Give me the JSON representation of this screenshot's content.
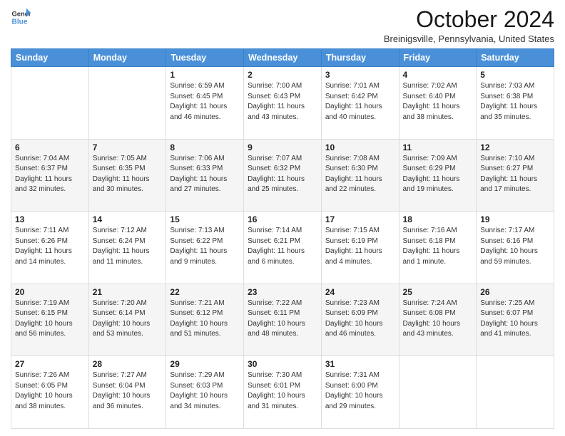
{
  "header": {
    "logo_line1": "General",
    "logo_line2": "Blue",
    "month": "October 2024",
    "location": "Breinigsville, Pennsylvania, United States"
  },
  "weekdays": [
    "Sunday",
    "Monday",
    "Tuesday",
    "Wednesday",
    "Thursday",
    "Friday",
    "Saturday"
  ],
  "weeks": [
    [
      {
        "day": "",
        "sunrise": "",
        "sunset": "",
        "daylight": ""
      },
      {
        "day": "",
        "sunrise": "",
        "sunset": "",
        "daylight": ""
      },
      {
        "day": "1",
        "sunrise": "Sunrise: 6:59 AM",
        "sunset": "Sunset: 6:45 PM",
        "daylight": "Daylight: 11 hours and 46 minutes."
      },
      {
        "day": "2",
        "sunrise": "Sunrise: 7:00 AM",
        "sunset": "Sunset: 6:43 PM",
        "daylight": "Daylight: 11 hours and 43 minutes."
      },
      {
        "day": "3",
        "sunrise": "Sunrise: 7:01 AM",
        "sunset": "Sunset: 6:42 PM",
        "daylight": "Daylight: 11 hours and 40 minutes."
      },
      {
        "day": "4",
        "sunrise": "Sunrise: 7:02 AM",
        "sunset": "Sunset: 6:40 PM",
        "daylight": "Daylight: 11 hours and 38 minutes."
      },
      {
        "day": "5",
        "sunrise": "Sunrise: 7:03 AM",
        "sunset": "Sunset: 6:38 PM",
        "daylight": "Daylight: 11 hours and 35 minutes."
      }
    ],
    [
      {
        "day": "6",
        "sunrise": "Sunrise: 7:04 AM",
        "sunset": "Sunset: 6:37 PM",
        "daylight": "Daylight: 11 hours and 32 minutes."
      },
      {
        "day": "7",
        "sunrise": "Sunrise: 7:05 AM",
        "sunset": "Sunset: 6:35 PM",
        "daylight": "Daylight: 11 hours and 30 minutes."
      },
      {
        "day": "8",
        "sunrise": "Sunrise: 7:06 AM",
        "sunset": "Sunset: 6:33 PM",
        "daylight": "Daylight: 11 hours and 27 minutes."
      },
      {
        "day": "9",
        "sunrise": "Sunrise: 7:07 AM",
        "sunset": "Sunset: 6:32 PM",
        "daylight": "Daylight: 11 hours and 25 minutes."
      },
      {
        "day": "10",
        "sunrise": "Sunrise: 7:08 AM",
        "sunset": "Sunset: 6:30 PM",
        "daylight": "Daylight: 11 hours and 22 minutes."
      },
      {
        "day": "11",
        "sunrise": "Sunrise: 7:09 AM",
        "sunset": "Sunset: 6:29 PM",
        "daylight": "Daylight: 11 hours and 19 minutes."
      },
      {
        "day": "12",
        "sunrise": "Sunrise: 7:10 AM",
        "sunset": "Sunset: 6:27 PM",
        "daylight": "Daylight: 11 hours and 17 minutes."
      }
    ],
    [
      {
        "day": "13",
        "sunrise": "Sunrise: 7:11 AM",
        "sunset": "Sunset: 6:26 PM",
        "daylight": "Daylight: 11 hours and 14 minutes."
      },
      {
        "day": "14",
        "sunrise": "Sunrise: 7:12 AM",
        "sunset": "Sunset: 6:24 PM",
        "daylight": "Daylight: 11 hours and 11 minutes."
      },
      {
        "day": "15",
        "sunrise": "Sunrise: 7:13 AM",
        "sunset": "Sunset: 6:22 PM",
        "daylight": "Daylight: 11 hours and 9 minutes."
      },
      {
        "day": "16",
        "sunrise": "Sunrise: 7:14 AM",
        "sunset": "Sunset: 6:21 PM",
        "daylight": "Daylight: 11 hours and 6 minutes."
      },
      {
        "day": "17",
        "sunrise": "Sunrise: 7:15 AM",
        "sunset": "Sunset: 6:19 PM",
        "daylight": "Daylight: 11 hours and 4 minutes."
      },
      {
        "day": "18",
        "sunrise": "Sunrise: 7:16 AM",
        "sunset": "Sunset: 6:18 PM",
        "daylight": "Daylight: 11 hours and 1 minute."
      },
      {
        "day": "19",
        "sunrise": "Sunrise: 7:17 AM",
        "sunset": "Sunset: 6:16 PM",
        "daylight": "Daylight: 10 hours and 59 minutes."
      }
    ],
    [
      {
        "day": "20",
        "sunrise": "Sunrise: 7:19 AM",
        "sunset": "Sunset: 6:15 PM",
        "daylight": "Daylight: 10 hours and 56 minutes."
      },
      {
        "day": "21",
        "sunrise": "Sunrise: 7:20 AM",
        "sunset": "Sunset: 6:14 PM",
        "daylight": "Daylight: 10 hours and 53 minutes."
      },
      {
        "day": "22",
        "sunrise": "Sunrise: 7:21 AM",
        "sunset": "Sunset: 6:12 PM",
        "daylight": "Daylight: 10 hours and 51 minutes."
      },
      {
        "day": "23",
        "sunrise": "Sunrise: 7:22 AM",
        "sunset": "Sunset: 6:11 PM",
        "daylight": "Daylight: 10 hours and 48 minutes."
      },
      {
        "day": "24",
        "sunrise": "Sunrise: 7:23 AM",
        "sunset": "Sunset: 6:09 PM",
        "daylight": "Daylight: 10 hours and 46 minutes."
      },
      {
        "day": "25",
        "sunrise": "Sunrise: 7:24 AM",
        "sunset": "Sunset: 6:08 PM",
        "daylight": "Daylight: 10 hours and 43 minutes."
      },
      {
        "day": "26",
        "sunrise": "Sunrise: 7:25 AM",
        "sunset": "Sunset: 6:07 PM",
        "daylight": "Daylight: 10 hours and 41 minutes."
      }
    ],
    [
      {
        "day": "27",
        "sunrise": "Sunrise: 7:26 AM",
        "sunset": "Sunset: 6:05 PM",
        "daylight": "Daylight: 10 hours and 38 minutes."
      },
      {
        "day": "28",
        "sunrise": "Sunrise: 7:27 AM",
        "sunset": "Sunset: 6:04 PM",
        "daylight": "Daylight: 10 hours and 36 minutes."
      },
      {
        "day": "29",
        "sunrise": "Sunrise: 7:29 AM",
        "sunset": "Sunset: 6:03 PM",
        "daylight": "Daylight: 10 hours and 34 minutes."
      },
      {
        "day": "30",
        "sunrise": "Sunrise: 7:30 AM",
        "sunset": "Sunset: 6:01 PM",
        "daylight": "Daylight: 10 hours and 31 minutes."
      },
      {
        "day": "31",
        "sunrise": "Sunrise: 7:31 AM",
        "sunset": "Sunset: 6:00 PM",
        "daylight": "Daylight: 10 hours and 29 minutes."
      },
      {
        "day": "",
        "sunrise": "",
        "sunset": "",
        "daylight": ""
      },
      {
        "day": "",
        "sunrise": "",
        "sunset": "",
        "daylight": ""
      }
    ]
  ]
}
